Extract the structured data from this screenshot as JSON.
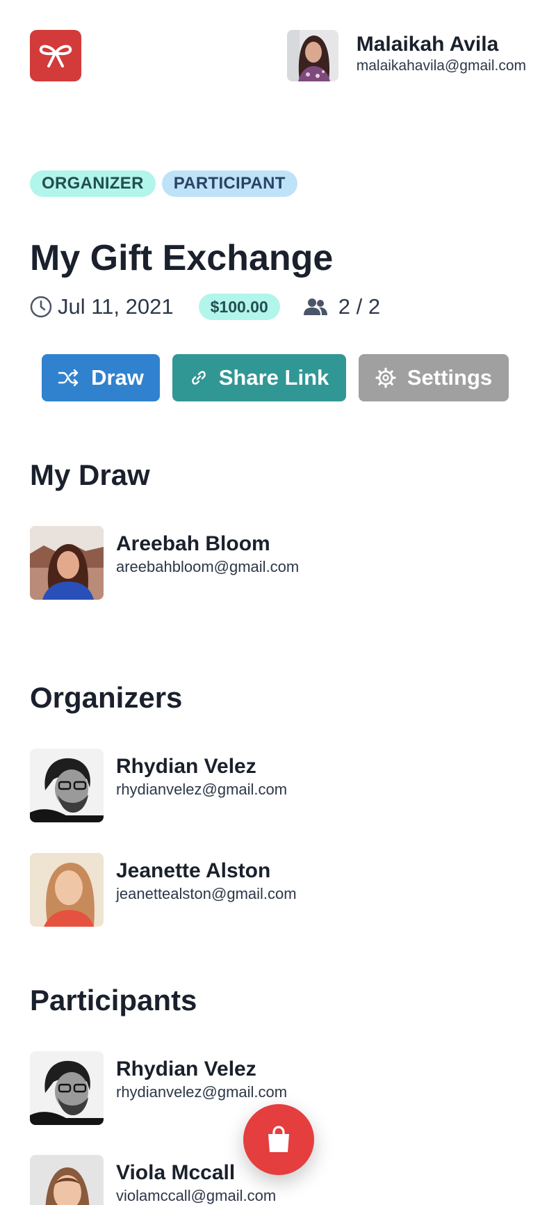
{
  "app": {
    "logo_icon": "ribbon-bow-icon",
    "brand_color": "#d33a3a"
  },
  "user": {
    "name": "Malaikah Avila",
    "email": "malaikahavila@gmail.com"
  },
  "roles": [
    "ORGANIZER",
    "PARTICIPANT"
  ],
  "exchange": {
    "title": "My Gift Exchange",
    "date": "Jul 11, 2021",
    "budget": "$100.00",
    "participants_count": "2 / 2"
  },
  "actions": {
    "draw_label": "Draw",
    "share_label": "Share Link",
    "settings_label": "Settings"
  },
  "my_draw": {
    "title": "My Draw",
    "person": {
      "name": "Areebah Bloom",
      "email": "areebahbloom@gmail.com"
    }
  },
  "organizers": {
    "title": "Organizers",
    "items": [
      {
        "name": "Rhydian Velez",
        "email": "rhydianvelez@gmail.com"
      },
      {
        "name": "Jeanette Alston",
        "email": "jeanettealston@gmail.com"
      }
    ]
  },
  "participants": {
    "title": "Participants",
    "items": [
      {
        "name": "Rhydian Velez",
        "email": "rhydianvelez@gmail.com"
      },
      {
        "name": "Viola Mccall",
        "email": "violamccall@gmail.com"
      }
    ]
  },
  "fab": {
    "icon": "shopping-bag-icon",
    "color": "#e53e3e"
  }
}
